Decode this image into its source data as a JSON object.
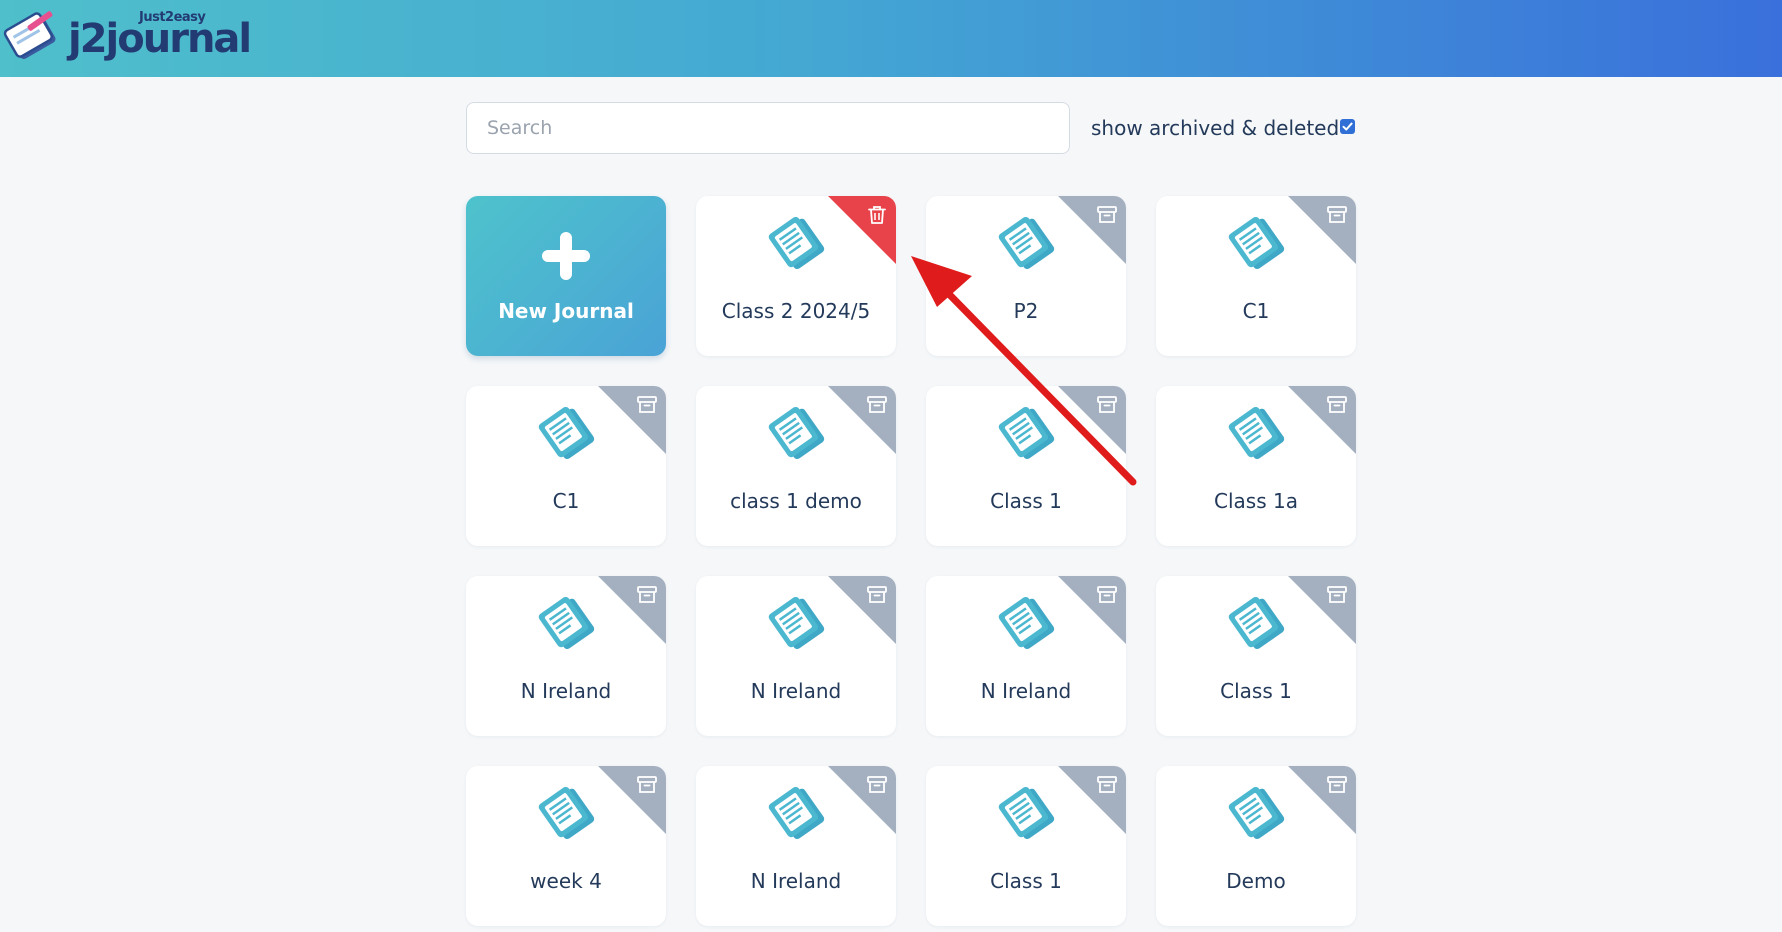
{
  "header": {
    "logo_sub": "Just2easy",
    "logo_main": "j2journal"
  },
  "search": {
    "placeholder": "Search",
    "value": ""
  },
  "filter": {
    "label": "show archived & deleted",
    "checked": true
  },
  "new_journal": {
    "label": "New Journal",
    "icon": "plus-icon"
  },
  "journals": [
    {
      "title": "Class 2 2024/5",
      "status": "deleted",
      "corner_icon": "trash-icon"
    },
    {
      "title": "P2",
      "status": "archived",
      "corner_icon": "archive-icon"
    },
    {
      "title": "C1",
      "status": "archived",
      "corner_icon": "archive-icon"
    },
    {
      "title": "C1",
      "status": "archived",
      "corner_icon": "archive-icon"
    },
    {
      "title": "class 1 demo",
      "status": "archived",
      "corner_icon": "archive-icon"
    },
    {
      "title": "Class 1",
      "status": "archived",
      "corner_icon": "archive-icon"
    },
    {
      "title": "Class 1a",
      "status": "archived",
      "corner_icon": "archive-icon"
    },
    {
      "title": "N Ireland",
      "status": "archived",
      "corner_icon": "archive-icon"
    },
    {
      "title": "N Ireland",
      "status": "archived",
      "corner_icon": "archive-icon"
    },
    {
      "title": "N Ireland",
      "status": "archived",
      "corner_icon": "archive-icon"
    },
    {
      "title": "Class 1",
      "status": "archived",
      "corner_icon": "archive-icon"
    },
    {
      "title": "week 4",
      "status": "archived",
      "corner_icon": "archive-icon"
    },
    {
      "title": "N Ireland",
      "status": "archived",
      "corner_icon": "archive-icon"
    },
    {
      "title": "Class 1",
      "status": "archived",
      "corner_icon": "archive-icon"
    },
    {
      "title": "Demo",
      "status": "archived",
      "corner_icon": "archive-icon"
    }
  ],
  "colors": {
    "header_start": "#4fbfcb",
    "header_end": "#3a70db",
    "archived_corner": "#a4b0c0",
    "deleted_corner": "#e8434a",
    "annotation_arrow": "#e01b1b",
    "journal_icon": "#4bb8d0"
  }
}
